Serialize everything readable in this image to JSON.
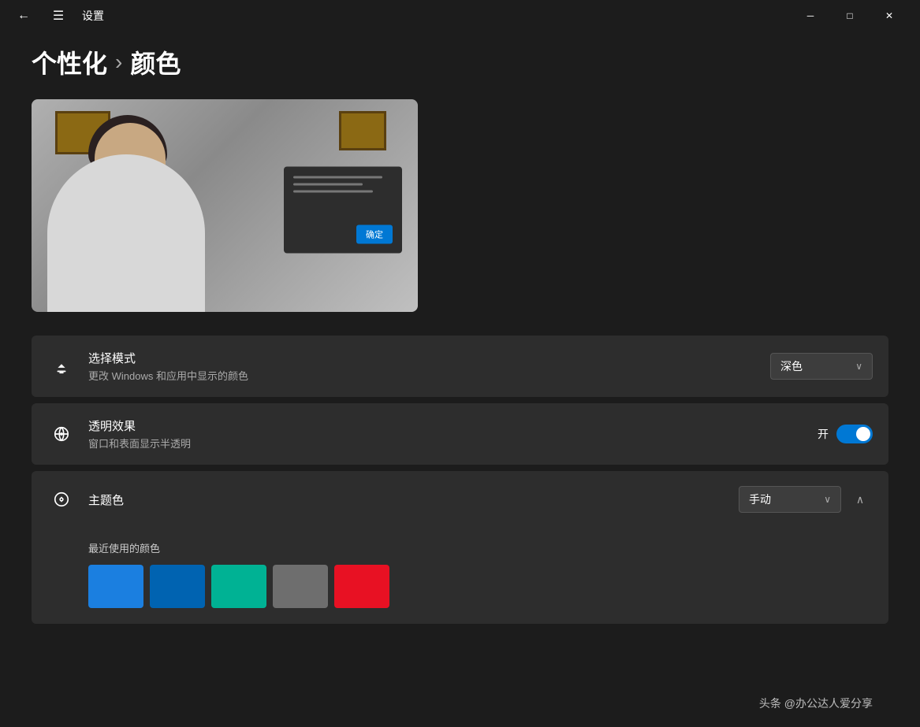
{
  "titleBar": {
    "title": "设置",
    "minimize": "─",
    "maximize": "□",
    "close": "✕"
  },
  "breadcrumb": {
    "parent": "个性化",
    "separator": "›",
    "current": "颜色"
  },
  "settings": {
    "modeSection": {
      "icon": "🖌",
      "title": "选择模式",
      "desc": "更改 Windows 和应用中显示的颜色",
      "dropdownValue": "深色",
      "dropdownArrow": "∨"
    },
    "transparencySection": {
      "icon": "✦",
      "title": "透明效果",
      "desc": "窗口和表面显示半透明",
      "toggleLabel": "开",
      "toggleOn": true
    },
    "themeColorSection": {
      "icon": "🎨",
      "title": "主题色",
      "dropdownValue": "手动",
      "dropdownArrow": "∨",
      "expandArrow": "∧",
      "recentColorsLabel": "最近使用的颜色",
      "colors": [
        "#1b7fe0",
        "#0063b1",
        "#00b294",
        "#6e6e6e",
        "#e81123"
      ]
    }
  },
  "dialog": {
    "okLabel": "确定"
  },
  "watermark": "头条 @办公达人爱分享"
}
